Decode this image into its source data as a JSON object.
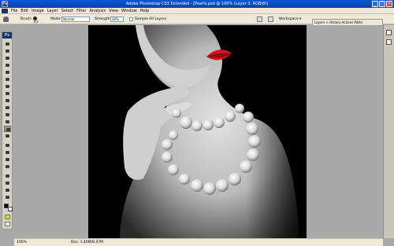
{
  "window": {
    "title": "Adobe Photoshop CS3 Extended - [Pearls.psd @ 100% (Layer 3, RGB/8)]",
    "app_icon": "Ps",
    "controls": [
      "_",
      "□",
      "×"
    ]
  },
  "menubar": {
    "items": [
      "File",
      "Edit",
      "Image",
      "Layer",
      "Select",
      "Filter",
      "Analysis",
      "View",
      "Window",
      "Help"
    ]
  },
  "options": {
    "brush_label": "Brush:",
    "brush_size": "100",
    "mode_label": "Mode:",
    "mode_value": "Normal",
    "strength_label": "Strength:",
    "strength_value": "30%",
    "sample_all_label": "Sample All Layers",
    "workspace_label": "Workspace ▾"
  },
  "panels": {
    "tabs": "Layers × History  Actions  Paths"
  },
  "toolbox": {
    "logo": "Ps",
    "tools": [
      "move-tool",
      "marquee-tool",
      "lasso-tool",
      "quick-select-tool",
      "crop-tool",
      "slice-tool",
      "healing-brush-tool",
      "brush-tool",
      "clone-stamp-tool",
      "history-brush-tool",
      "eraser-tool",
      "gradient-tool",
      "smudge-tool",
      "dodge-tool",
      "pen-tool",
      "type-tool",
      "path-select-tool",
      "shape-tool",
      "notes-tool",
      "eyedropper-tool",
      "hand-tool",
      "zoom-tool"
    ],
    "foreground_color": "#000000",
    "background_color": "#ffffff",
    "quick_mask_color": "#c8e800"
  },
  "status": {
    "zoom": "100%",
    "doc_info": "Doc: 1.40M/8.47M"
  },
  "colors": {
    "title_bar": "#0a56d8",
    "chrome": "#ece9d8",
    "workspace": "#a9a9a9",
    "lips": "#d4141c"
  }
}
